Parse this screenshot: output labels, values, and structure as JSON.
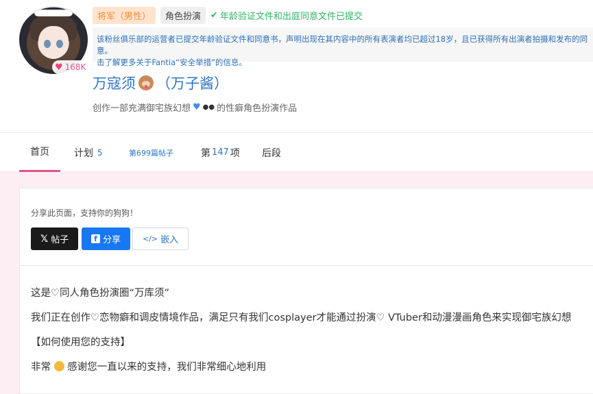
{
  "creator": {
    "likes": "168K",
    "tags": {
      "gender": "将军（男性）",
      "genre": "角色扮演",
      "verified": "年龄验证文件和出庭同意文件已提交"
    },
    "notice_line1": "该粉丝俱乐部的运营者已提交年龄验证文件和同意书，声明出现在其内容中的所有表演者均已超过18岁，且已获得所有出演者拍摄和发布的同意。",
    "notice_line2": "击了解更多关于Fantia“安全举措”的信息。",
    "name": "万寇须",
    "name_suffix": "（万子酱）",
    "tagline_a": "创作一部充满御宅族幻想",
    "tagline_b": "的性癖角色扮演作品"
  },
  "tabs": {
    "home": "首页",
    "plans": "计划",
    "plans_count": "5",
    "posts": "第699篇帖子",
    "items_prefix": "第",
    "items_count": "147",
    "items_suffix": "项",
    "backstage": "后段"
  },
  "share": {
    "hint": "分享此页面，支持你的狗狗！",
    "x_label": "帖子",
    "fb_label": "分享",
    "embed_label": "嵌入"
  },
  "description": {
    "p1": "这是♡同人角色扮演圈“万库须”",
    "p2": "我们正在创作♡恋物癖和调皮情境作品，满足只有我们cosplayer才能通过扮演♡ VTuber和动漫漫画角色来实现御宅族幻想",
    "p3": "【如何使用您的支持】",
    "p4_a": "非常",
    "p4_b": "感谢您一直以来的支持，我们非常细心地利用"
  }
}
